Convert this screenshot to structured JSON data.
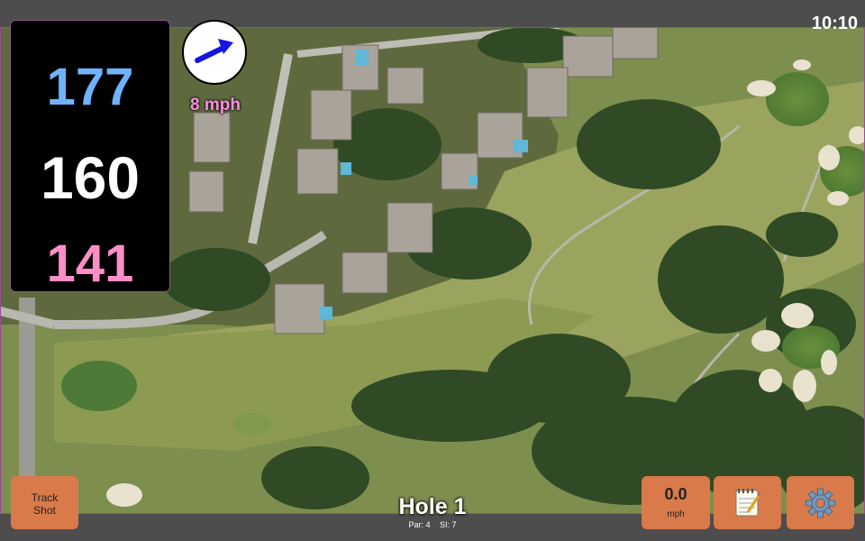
{
  "status": {
    "time": "10:10"
  },
  "distances": {
    "back": "177",
    "center": "160",
    "front": "141"
  },
  "wind": {
    "speed_label": "8 mph",
    "icon": "wind-arrow-icon"
  },
  "buttons": {
    "track_shot_line1": "Track",
    "track_shot_line2": "Shot",
    "speed_value": "0.0",
    "speed_unit": "mph",
    "notes_icon": "notepad-icon",
    "settings_icon": "gear-icon"
  },
  "hole": {
    "title": "Hole 1",
    "par_label": "Par: 4",
    "si_label": "SI: 7"
  },
  "colors": {
    "back": "#6fb3ff",
    "center": "#ffffff",
    "front": "#ff8ec8",
    "button": "#d97a4a",
    "wind_text": "#ff8ee0"
  }
}
